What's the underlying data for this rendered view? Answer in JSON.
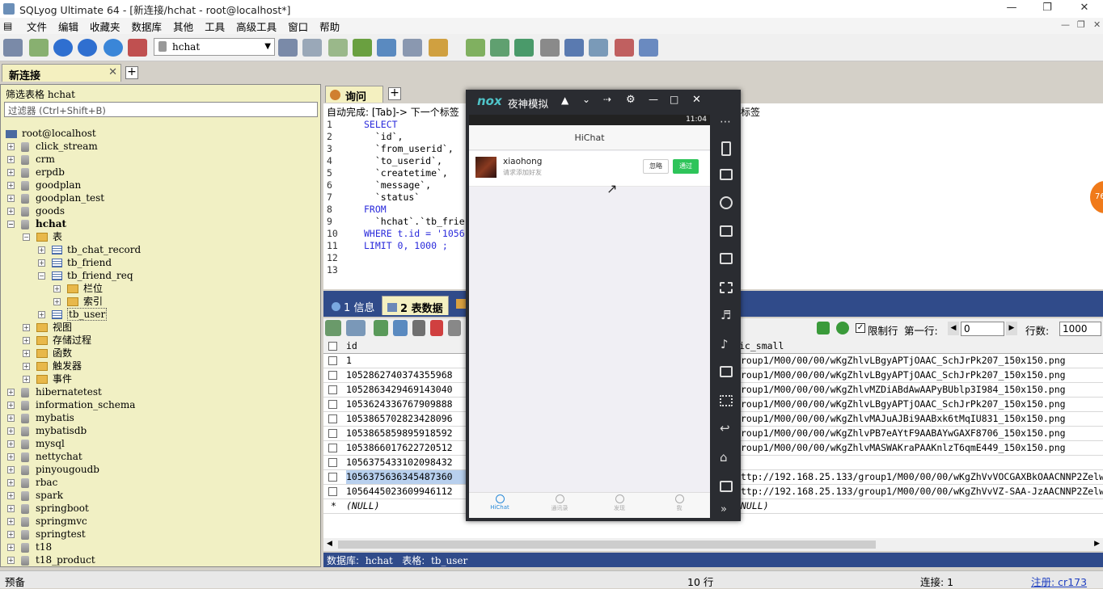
{
  "window": {
    "title": "SQLyog Ultimate 64 - [新连接/hchat - root@localhost*]"
  },
  "menu": [
    "文件",
    "编辑",
    "收藏夹",
    "数据库",
    "其他",
    "工具",
    "高级工具",
    "窗口",
    "帮助"
  ],
  "toolbar": {
    "db_selector": "hchat"
  },
  "connection_tab": {
    "label": "新连接"
  },
  "sidebar": {
    "header": "筛选表格 hchat",
    "filter_placeholder": "过滤器 (Ctrl+Shift+B)",
    "root": "root@localhost",
    "dbs_before": [
      "click_stream",
      "crm",
      "erpdb",
      "goodplan",
      "goodplan_test",
      "goods"
    ],
    "hchat": "hchat",
    "tables_folder": "表",
    "tables": [
      "tb_chat_record",
      "tb_friend",
      "tb_friend_req"
    ],
    "sub_folders": [
      "栏位",
      "索引"
    ],
    "tb_user": "tb_user",
    "other_folders": [
      "视图",
      "存储过程",
      "函数",
      "触发器",
      "事件"
    ],
    "dbs_after": [
      "hibernatetest",
      "information_schema",
      "mybatis",
      "mybatisdb",
      "mysql",
      "nettychat",
      "pinyougoudb",
      "rbac",
      "spark",
      "springboot",
      "springmvc",
      "springtest",
      "t18",
      "t18_product"
    ]
  },
  "query_tab": {
    "label": "询问"
  },
  "autocomplete_hint": "自动完成: [Tab]-> 下一个标签",
  "autocomplete_hint_right": "配标签",
  "editor": {
    "line_numbers": [
      "1",
      "2",
      "3",
      "4",
      "5",
      "6",
      "7",
      "8",
      "9",
      "10",
      "11",
      "12",
      "13"
    ],
    "lines": [
      "SELECT",
      "  `id`,",
      "  `from_userid`,",
      "  `to_userid`,",
      "  `createtime`,",
      "  `message`,",
      "  `status`",
      "FROM",
      "  `hchat`.`tb_frie",
      "WHERE t.id = '1056",
      "LIMIT 0, 1000 ;",
      "",
      ""
    ]
  },
  "result_tabs": {
    "info": "1 信息",
    "table_data": "2 表数据"
  },
  "result_toolbar": {
    "limit_label": "限制行",
    "first_row_label": "第一行:",
    "first_row_value": "0",
    "rows_label": "行数:",
    "rows_value": "1000"
  },
  "grid": {
    "headers": [
      "id",
      "ic_small"
    ],
    "rows": [
      [
        "1",
        "roup1/M00/00/00/wKgZhlvLBgyAPTjOAAC_SchJrPk207_150x150.png"
      ],
      [
        "1052862740374355968",
        "roup1/M00/00/00/wKgZhlvLBgyAPTjOAAC_SchJrPk207_150x150.png"
      ],
      [
        "1052863429469143040",
        "roup1/M00/00/00/wKgZhlvMZDiABdAwAAPyBUblp3I984_150x150.png"
      ],
      [
        "1053624336767909888",
        "roup1/M00/00/00/wKgZhlvLBgyAPTjOAAC_SchJrPk207_150x150.png"
      ],
      [
        "1053865702823428096",
        "roup1/M00/00/00/wKgZhlvMAJuAJBi9AABxk6tMqIU831_150x150.png"
      ],
      [
        "1053865859895918592",
        "roup1/M00/00/00/wKgZhlvPB7eAYtF9AABAYwGAXF8706_150x150.png"
      ],
      [
        "1053866017622720512",
        "roup1/M00/00/00/wKgZhlvMASWAKraPAAKnlzT6qmE449_150x150.png"
      ],
      [
        "1056375433102098432",
        ""
      ],
      [
        "1056375636345487360",
        "ttp://192.168.25.133/group1/M00/00/00/wKgZhVvVOCGAXBkOAACNNP2Zelw"
      ],
      [
        "1056445023609946112",
        "ttp://192.168.25.133/group1/M00/00/00/wKgZhVvVZ-SAA-JzAACNNP2Zelw"
      ],
      [
        "(NULL)",
        "NULL)"
      ]
    ]
  },
  "info_bar": {
    "db_label": "数据库:",
    "db": "hchat",
    "table_label": "表格:",
    "table": "tb_user"
  },
  "status": {
    "left": "预备",
    "rows": "10 行",
    "connection": "连接: 1",
    "register": "注册: cr173"
  },
  "emulator": {
    "title": "夜神模拟",
    "logo": "nox",
    "time": "11:04",
    "app_title": "HiChat",
    "request": {
      "name": "xiaohong",
      "subtitle": "请求添加好友",
      "ignore": "忽略",
      "accept": "通过"
    },
    "nav": [
      "HiChat",
      "通讯录",
      "发现",
      "我"
    ]
  },
  "badge": "76"
}
